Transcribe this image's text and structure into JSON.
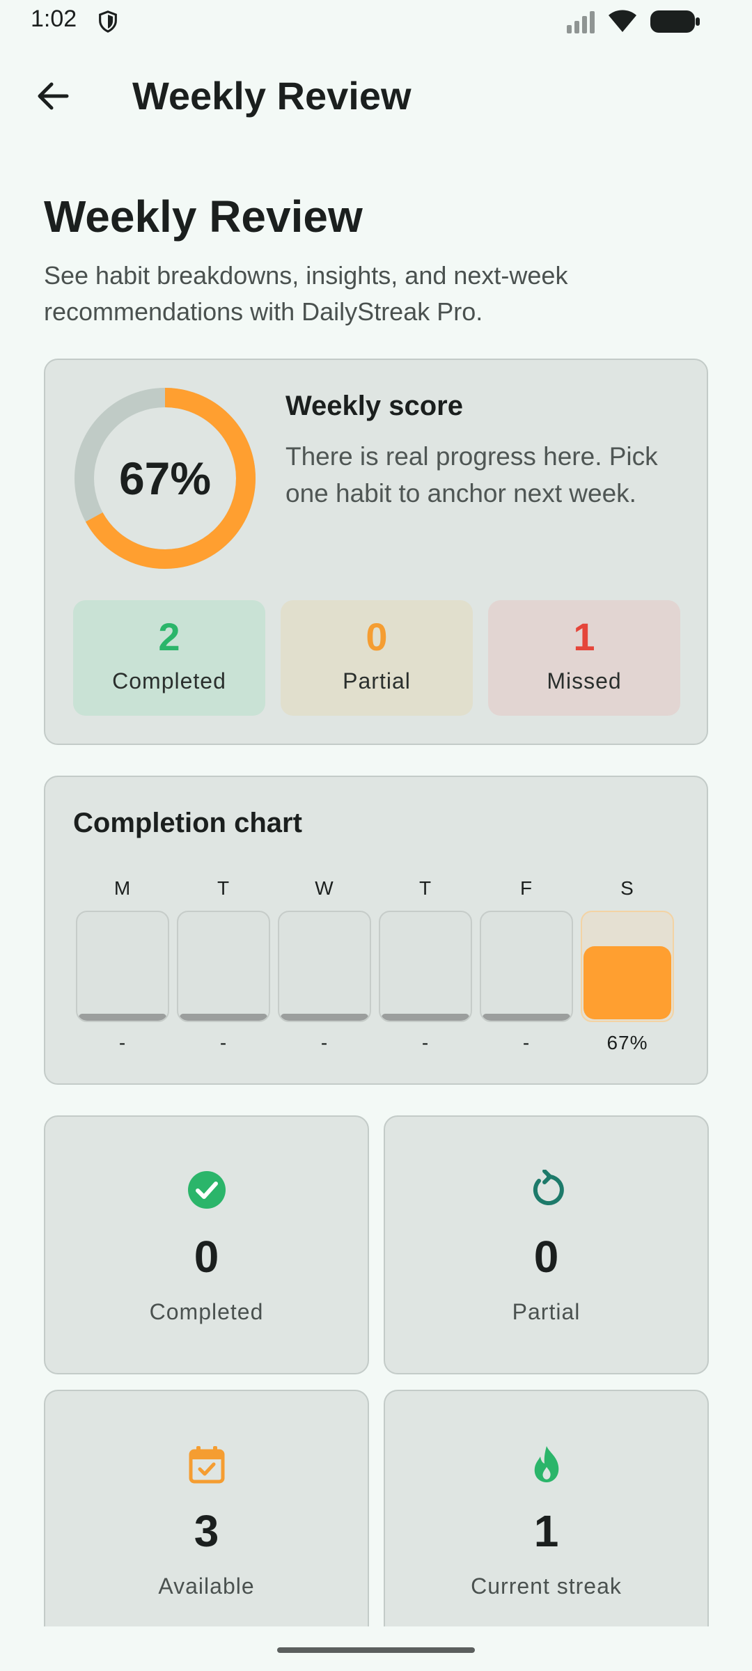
{
  "status_bar": {
    "time": "1:02"
  },
  "app_bar": {
    "title": "Weekly Review"
  },
  "header": {
    "title": "Weekly Review",
    "subtitle": "See habit breakdowns, insights, and next-week recommendations with DailyStreak Pro."
  },
  "score": {
    "percent_label": "67%",
    "fraction": 0.67,
    "title": "Weekly score",
    "description": "There is real progress here. Pick one habit to anchor next week.",
    "accent": "#ff9f30",
    "track": "#c0cbc6"
  },
  "summary": [
    {
      "value": "2",
      "label": "Completed"
    },
    {
      "value": "0",
      "label": "Partial"
    },
    {
      "value": "1",
      "label": "Missed"
    }
  ],
  "chart_data": {
    "type": "bar",
    "title": "Completion chart",
    "categories": [
      "M",
      "T",
      "W",
      "T",
      "F",
      "S"
    ],
    "values": [
      null,
      null,
      null,
      null,
      null,
      67
    ],
    "value_labels": [
      "-",
      "-",
      "-",
      "-",
      "-",
      "67%"
    ],
    "ylim": [
      0,
      100
    ]
  },
  "tiles": [
    {
      "icon": "check-circle-icon",
      "value": "0",
      "label": "Completed",
      "color": "#2bb56a"
    },
    {
      "icon": "refresh-icon",
      "value": "0",
      "label": "Partial",
      "color": "#1d7a6a"
    },
    {
      "icon": "calendar-check-icon",
      "value": "3",
      "label": "Available",
      "color": "#f59d31"
    },
    {
      "icon": "flame-icon",
      "value": "1",
      "label": "Current streak",
      "color": "#2bb56a"
    }
  ]
}
